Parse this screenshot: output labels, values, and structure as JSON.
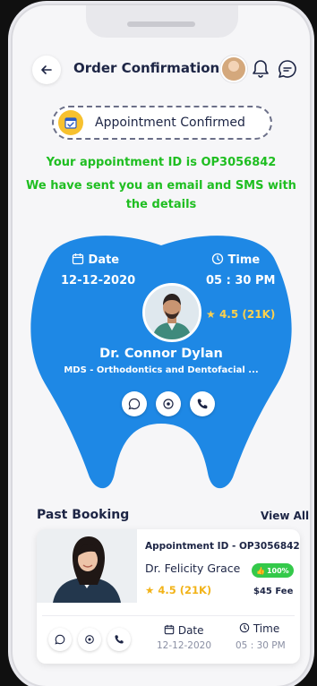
{
  "header": {
    "title": "Order Confirmation",
    "icons": [
      "back-arrow-icon",
      "avatar",
      "bell-icon",
      "chat-icon"
    ]
  },
  "confirmation": {
    "badge_text": "Appointment Confirmed",
    "appointment_line": "Your appointment ID is OP3056842",
    "message_line1": "We have sent you an email and SMS with",
    "message_line2": "the details"
  },
  "appointment": {
    "date_label": "Date",
    "date_value": "12-12-2020",
    "time_label": "Time",
    "time_value": "05 : 30 PM",
    "rating": "4.5 (21K)",
    "doctor_name": "Dr. Connor Dylan",
    "doctor_specialty": "MDS - Orthodontics and Dentofacial ...",
    "actions": [
      "chat-icon",
      "location-icon",
      "phone-icon"
    ]
  },
  "past_booking": {
    "title": "Past Booking",
    "view_all": "View All",
    "card": {
      "appointment_id": "Appointment ID - OP3056842",
      "doctor_name": "Dr. Felicity Grace",
      "badge": "100%",
      "rating": "4.5 (21K)",
      "fee": "$45 Fee",
      "date_label": "Date",
      "date_value": "12-12-2020",
      "time_label": "Time",
      "time_value": "05 : 30 PM"
    }
  },
  "colors": {
    "primary_blue": "#1e88e5",
    "success_green": "#1fbe21",
    "accent_yellow": "#f7c12f",
    "dark_text": "#1d2545"
  }
}
